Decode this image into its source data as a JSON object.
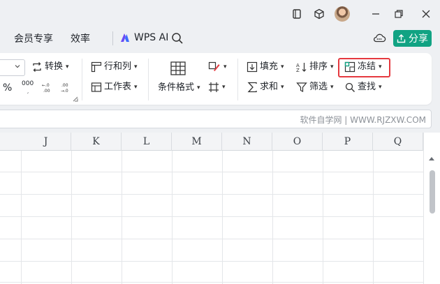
{
  "menu": {
    "items": [
      "会员专享",
      "效率"
    ],
    "ai_label": "WPS AI",
    "share_label": "分享"
  },
  "ribbon": {
    "convert_label": "转换",
    "row_col_label": "行和列",
    "worksheet_label": "工作表",
    "cond_format_label": "条件格式",
    "fill_label": "填充",
    "sort_label": "排序",
    "freeze_label": "冻结",
    "sum_label": "求和",
    "filter_label": "筛选",
    "find_label": "查找",
    "percent_label": "%",
    "thousands_label": "000"
  },
  "watermark": "软件自学网 | WWW.RJZXW.COM",
  "columns": [
    "J",
    "K",
    "L",
    "M",
    "N",
    "O",
    "P",
    "Q"
  ],
  "colors": {
    "accent": "#11a383",
    "highlight": "#e5393f"
  }
}
